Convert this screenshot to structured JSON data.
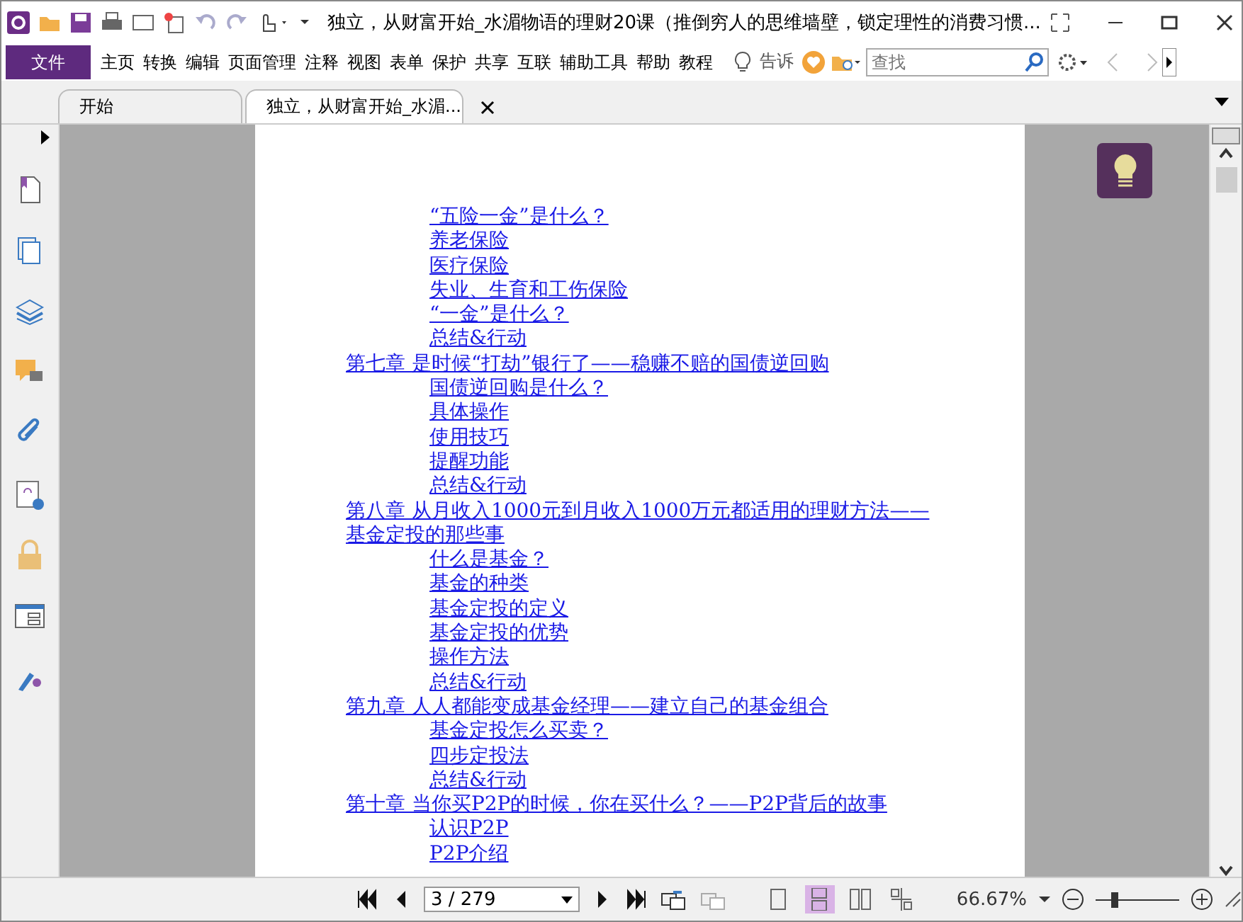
{
  "window": {
    "title": "独立，从财富开始_水湄物语的理财20课（推倒穷人的思维墙壁，锁定理性的消费习惯..."
  },
  "menu": [
    {
      "label": "文件",
      "selected": true
    },
    {
      "label": "主页",
      "selected": false
    },
    {
      "label": "转换",
      "selected": false
    },
    {
      "label": "编辑",
      "selected": false
    },
    {
      "label": "页面管理",
      "selected": false
    },
    {
      "label": "注释",
      "selected": false
    },
    {
      "label": "视图",
      "selected": false
    },
    {
      "label": "表单",
      "selected": false
    },
    {
      "label": "保护",
      "selected": false
    },
    {
      "label": "共享",
      "selected": false
    },
    {
      "label": "互联",
      "selected": false
    },
    {
      "label": "辅助工具",
      "selected": false
    },
    {
      "label": "帮助",
      "selected": false
    },
    {
      "label": "教程",
      "selected": false
    }
  ],
  "tell_me": "告诉",
  "search": {
    "placeholder": "查找"
  },
  "tabs": [
    {
      "label": "开始",
      "selected": false
    },
    {
      "label": "独立，从财富开始_水湄...",
      "selected": true,
      "closable": true
    }
  ],
  "toc": [
    {
      "children": [
        {
          "title": "“五险一金”是什么？"
        },
        {
          "title": "养老保险"
        },
        {
          "title": "医疗保险"
        },
        {
          "title": "失业、生育和工伤保险"
        },
        {
          "title": "“一金”是什么？"
        },
        {
          "title": "总结&行动"
        }
      ]
    },
    {
      "title": "第七章 是时候“打劫”银行了——稳赚不赔的国债逆回购",
      "children": [
        {
          "title": "国债逆回购是什么？"
        },
        {
          "title": "具体操作"
        },
        {
          "title": "使用技巧"
        },
        {
          "title": "提醒功能"
        },
        {
          "title": "总结&行动"
        }
      ]
    },
    {
      "title": "第八章 从月收入1000元到月收入1000万元都适用的理财方法——基金定投的那些事",
      "children": [
        {
          "title": "什么是基金？"
        },
        {
          "title": "基金的种类"
        },
        {
          "title": "基金定投的定义"
        },
        {
          "title": "基金定投的优势"
        },
        {
          "title": "操作方法"
        },
        {
          "title": "总结&行动"
        }
      ]
    },
    {
      "title": "第九章 人人都能变成基金经理——建立自己的基金组合",
      "children": [
        {
          "title": "基金定投怎么买卖？"
        },
        {
          "title": "四步定投法"
        },
        {
          "title": "总结&行动"
        }
      ]
    },
    {
      "title": "第十章 当你买P2P的时候，你在买什么？——P2P背后的故事",
      "children": [
        {
          "title": "认识P2P"
        },
        {
          "title": "P2P介绍"
        }
      ]
    }
  ],
  "status": {
    "page": "3 / 279",
    "zoom": "66.67%",
    "zoom_slider": {
      "level": 0.2
    },
    "view_modes": [
      {
        "kind": "single",
        "selected": false
      },
      {
        "kind": "continuous",
        "selected": true
      },
      {
        "kind": "facing",
        "selected": false
      },
      {
        "kind": "cover",
        "selected": false
      }
    ]
  }
}
